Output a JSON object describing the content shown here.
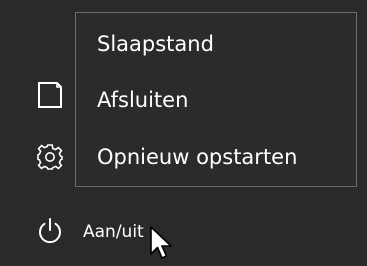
{
  "power_menu": {
    "items": [
      {
        "label": "Slaapstand"
      },
      {
        "label": "Afsluiten"
      },
      {
        "label": "Opnieuw opstarten"
      }
    ]
  },
  "rail": {
    "items": [
      {
        "icon": "document-icon"
      },
      {
        "icon": "gear-icon"
      },
      {
        "icon": "power-icon",
        "label": "Aan/uit"
      }
    ]
  },
  "colors": {
    "background": "#2b2b2b",
    "menu_border": "#6b6b6b",
    "text": "#ffffff"
  }
}
